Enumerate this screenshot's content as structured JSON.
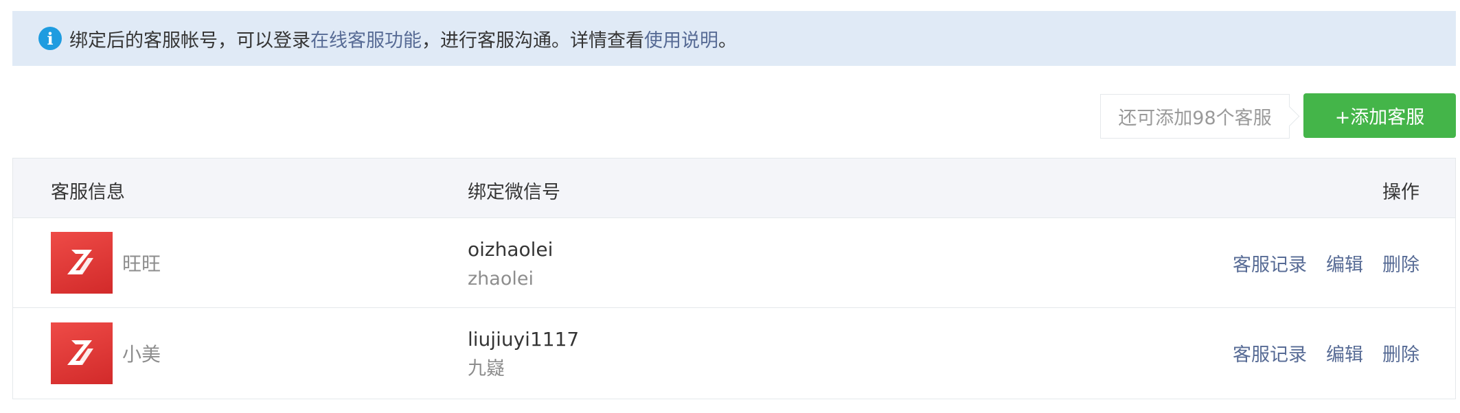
{
  "notice": {
    "icon": "info-icon",
    "icon_color": "#1e9ce0",
    "text_before": "绑定后的客服帐号，可以登录",
    "link_online": "在线客服功能",
    "text_middle": "，进行客服沟通。详情查看",
    "link_guide": "使用说明",
    "text_end": "。"
  },
  "toolbar": {
    "quota_text": "还可添加98个客服",
    "add_button_label": "+添加客服",
    "add_button_color": "#44b549"
  },
  "table": {
    "headers": {
      "info": "客服信息",
      "wechat": "绑定微信号",
      "ops": "操作"
    },
    "rows": [
      {
        "avatar": "brand-logo-icon",
        "name": "旺旺",
        "wechat_id": "oizhaolei",
        "wechat_nick": "zhaolei",
        "ops": [
          "客服记录",
          "编辑",
          "删除"
        ]
      },
      {
        "avatar": "brand-logo-icon",
        "name": "小美",
        "wechat_id": "liujiuyi1117",
        "wechat_nick": "九嶷",
        "ops": [
          "客服记录",
          "编辑",
          "删除"
        ]
      }
    ]
  },
  "colors": {
    "link": "#576b95",
    "banner_bg": "#e0eaf6",
    "header_bg": "#f4f5f9"
  }
}
